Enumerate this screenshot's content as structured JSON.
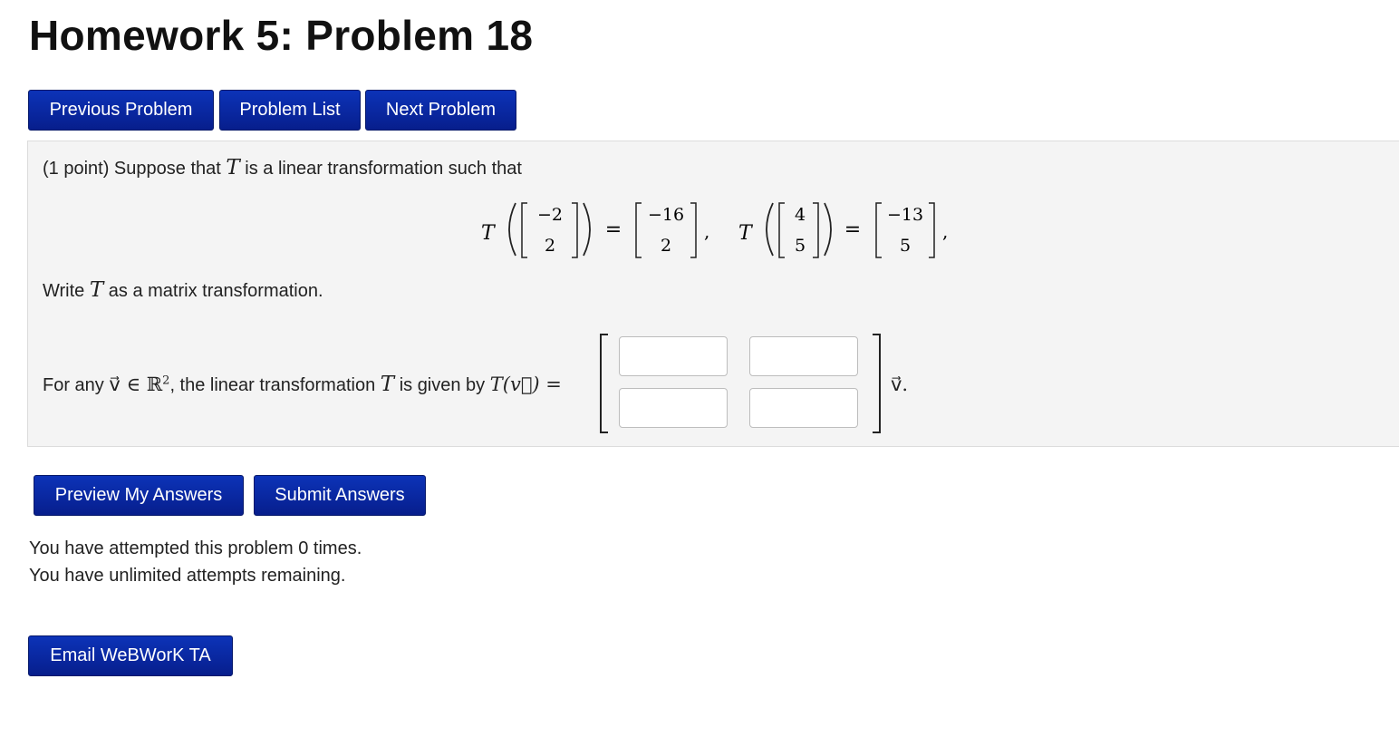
{
  "page": {
    "title": "Homework 5: Problem 18"
  },
  "nav": {
    "previous": "Previous Problem",
    "list": "Problem List",
    "next": "Next Problem"
  },
  "problem": {
    "intro_prefix": "(1 point) Suppose that",
    "intro_var": "T",
    "intro_suffix": "is a linear transformation such that",
    "eq1": {
      "fn": "T",
      "input": [
        "−2",
        "2"
      ],
      "output": [
        "−16",
        "2"
      ]
    },
    "eq2": {
      "fn": "T",
      "input": [
        "4",
        "5"
      ],
      "output": [
        "−13",
        "5"
      ]
    },
    "equals": "=",
    "separator": ",",
    "write_prefix": "Write",
    "write_var": "T",
    "write_suffix": "as a matrix transformation.",
    "forany_prefix": "For any",
    "forany_vec": "v⃗ ∈ ℝ",
    "forany_sup": "2",
    "forany_mid": ", the linear transformation",
    "forany_var": "T",
    "forany_given": "is given by",
    "forany_expr": "T(v⃗) =",
    "after_matrix": "v⃗.",
    "answers": [
      "",
      "",
      "",
      ""
    ]
  },
  "actions": {
    "preview": "Preview My Answers",
    "submit": "Submit Answers",
    "email": "Email WeBWorK TA"
  },
  "status": {
    "attempted": "You have attempted this problem 0 times.",
    "remaining": "You have unlimited attempts remaining."
  }
}
